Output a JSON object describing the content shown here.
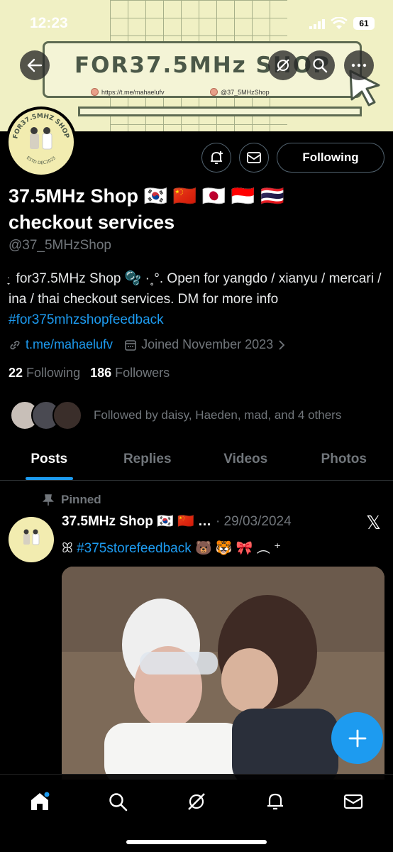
{
  "status_bar": {
    "time": "12:23",
    "battery": "61"
  },
  "banner": {
    "title": "FOR37.5MHz SHOP",
    "link_text": "https://t.me/mahaelufv",
    "handle_text": "@37_5MHzShop"
  },
  "avatar": {
    "badge_text": "FOR37.5MHZ SHOP",
    "estd_text": "ESTD DEC2023"
  },
  "profile": {
    "name_line1": "37.5MHz Shop 🇰🇷 🇨🇳 🇯🇵 🇮🇩 🇹🇭",
    "name_line2": "checkout services",
    "handle": "@37_5MHzShop",
    "bio": "ּ ָ for37.5MHz Shop 🫧 ·˳°. Open for yangdo / xianyu / mercari / ina / thai checkout services. DM for more info",
    "bio_hashtag": "#for375mhzshopfeedback",
    "link": "t.me/mahaelufv",
    "joined": "Joined November 2023",
    "following_count": "22",
    "following_label": "Following",
    "followers_count": "186",
    "followers_label": "Followers",
    "followed_by": "Followed by daisy, Haeden, mad, and 4 others",
    "follow_button": "Following"
  },
  "tabs": [
    {
      "label": "Posts"
    },
    {
      "label": "Replies"
    },
    {
      "label": "Videos"
    },
    {
      "label": "Photos"
    }
  ],
  "post": {
    "pinned_label": "Pinned",
    "author": "37.5MHz Shop 🇰🇷 🇨🇳 …",
    "date": "· 29/03/2024",
    "text_prefix": "ꕤ",
    "hashtag": "#375storefeedback",
    "text_suffix": "🐻 🐯 🎀 ︵ ⁺"
  },
  "colors": {
    "accent": "#1d9bf0",
    "background": "#000000",
    "muted": "#71767b",
    "banner": "#f0f0c4"
  }
}
